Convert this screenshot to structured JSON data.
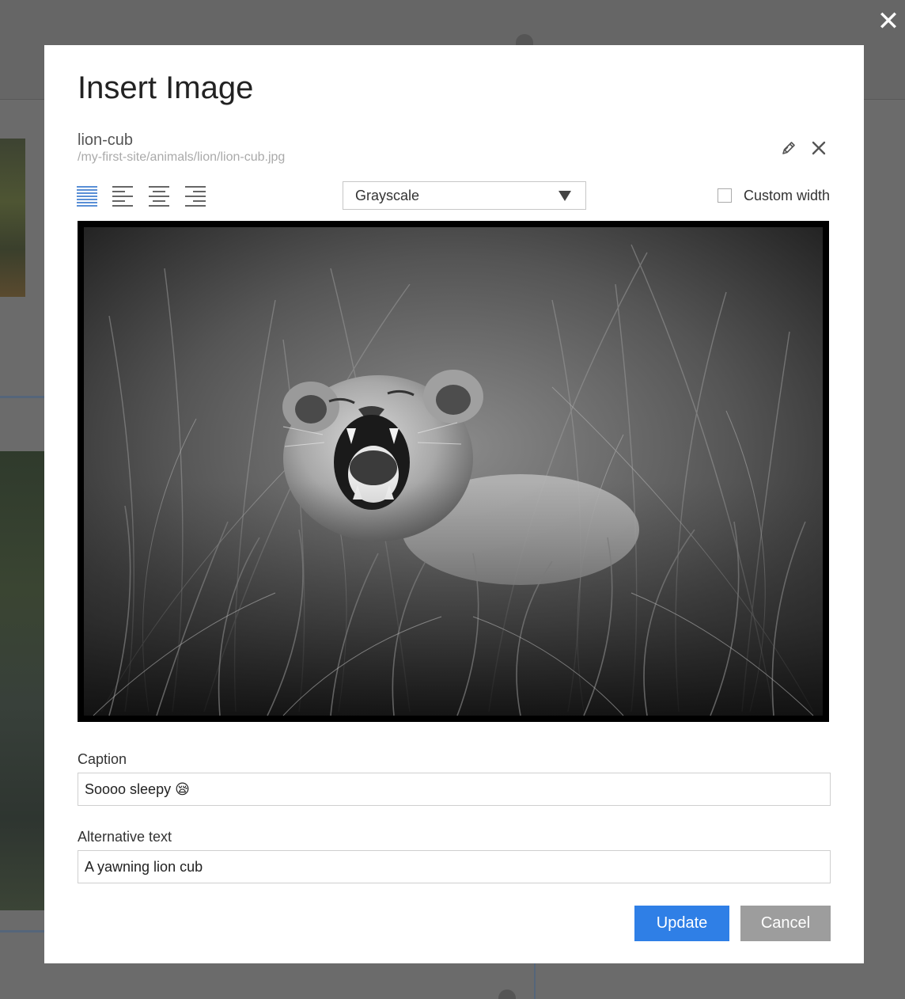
{
  "overlay": {
    "close_glyph": "✕"
  },
  "modal": {
    "title": "Insert Image",
    "file": {
      "name": "lion-cub",
      "path": "/my-first-site/animals/lion/lion-cub.jpg"
    },
    "icons": {
      "edit": "pencil-icon",
      "remove": "close-icon"
    },
    "alignment": {
      "options": [
        "full-width",
        "align-left",
        "align-center",
        "align-right"
      ],
      "selected": "full-width",
      "active_color": "#5a8fd6"
    },
    "filter": {
      "selected": "Grayscale"
    },
    "custom_width": {
      "label": "Custom width",
      "checked": false
    },
    "caption": {
      "label": "Caption",
      "value": "Soooo sleepy 😪"
    },
    "alt_text": {
      "label": "Alternative text",
      "value": "A yawning lion cub"
    },
    "buttons": {
      "update": "Update",
      "cancel": "Cancel"
    },
    "colors": {
      "primary": "#2f7fe6",
      "secondary": "#9d9d9d"
    }
  }
}
